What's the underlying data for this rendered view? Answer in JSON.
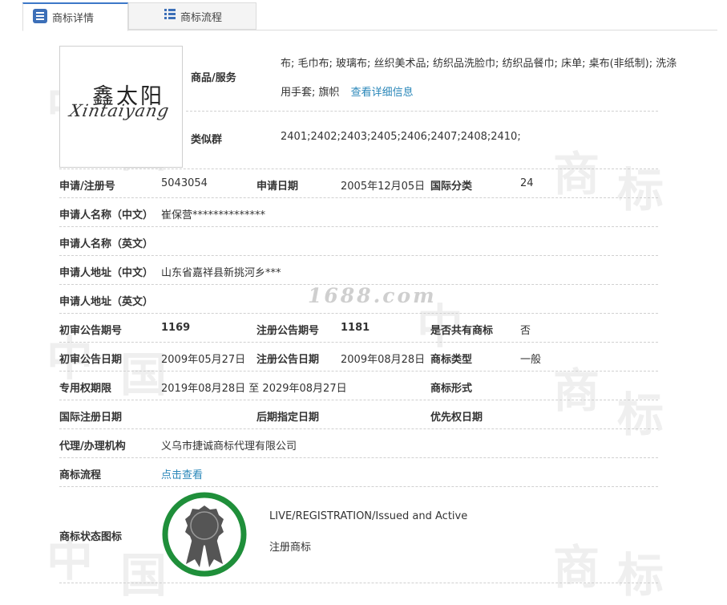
{
  "tabs": [
    {
      "label": "商标详情",
      "icon": "list-icon",
      "active": true
    },
    {
      "label": "商标流程",
      "icon": "grid-icon",
      "active": false
    }
  ],
  "watermark": "1688.com",
  "logo": {
    "cn_text": "鑫太阳",
    "en_text": "Xintaiyang"
  },
  "goods": {
    "label": "商品/服务",
    "line1": "布; 毛巾布; 玻璃布; 丝织美术品; 纺织品洗脸巾; 纺织品餐巾; 床单; 桌布(非纸制); 洗涤",
    "line2": "用手套; 旗帜",
    "link": "查看详细信息"
  },
  "similar_group": {
    "label": "类似群",
    "value": "2401;2402;2403;2405;2406;2407;2408;2410;"
  },
  "rows": {
    "reg_no": {
      "label": "申请/注册号",
      "value": "5043054"
    },
    "apply_date": {
      "label": "申请日期",
      "value": "2005年12月05日"
    },
    "intl_class": {
      "label": "国际分类",
      "value": "24"
    },
    "applicant_cn": {
      "label": "申请人名称（中文）",
      "value": "崔保营**************"
    },
    "applicant_en": {
      "label": "申请人名称（英文）",
      "value": ""
    },
    "address_cn": {
      "label": "申请人地址（中文）",
      "value": "山东省嘉祥县新挑河乡***"
    },
    "address_en": {
      "label": "申请人地址（英文）",
      "value": ""
    },
    "prelim_issue": {
      "label": "初审公告期号",
      "value": "1169"
    },
    "reg_issue": {
      "label": "注册公告期号",
      "value": "1181"
    },
    "shared": {
      "label": "是否共有商标",
      "value": "否"
    },
    "prelim_date": {
      "label": "初审公告日期",
      "value": "2009年05月27日"
    },
    "reg_date": {
      "label": "注册公告日期",
      "value": "2009年08月28日"
    },
    "mark_type": {
      "label": "商标类型",
      "value": "一般"
    },
    "exclusive_period": {
      "label": "专用权期限",
      "value": "2019年08月28日 至 2029年08月27日"
    },
    "mark_form": {
      "label": "商标形式",
      "value": ""
    },
    "intl_reg_date": {
      "label": "国际注册日期",
      "value": ""
    },
    "later_date": {
      "label": "后期指定日期",
      "value": ""
    },
    "priority_date": {
      "label": "优先权日期",
      "value": ""
    },
    "agent": {
      "label": "代理/办理机构",
      "value": "义乌市捷诚商标代理有限公司"
    },
    "process": {
      "label": "商标流程",
      "link": "点击查看"
    },
    "status_icon": {
      "label": "商标状态图标",
      "status_en": "LIVE/REGISTRATION/Issued and Active",
      "status_cn": "注册商标",
      "ring_color": "#1f8f3a",
      "badge_color": "#555555"
    }
  }
}
